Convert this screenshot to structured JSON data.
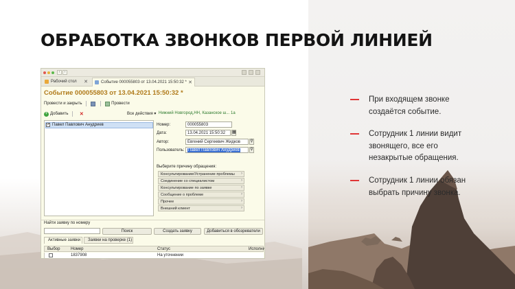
{
  "slide": {
    "title": "ОБРАБОТКА ЗВОНКОВ ПЕРВОЙ ЛИНИЕЙ",
    "accent_color": "#e03535",
    "bullets": [
      {
        "lines": [
          "При входящем звонке",
          "создаётся событие."
        ]
      },
      {
        "lines": [
          "Сотрудник 1 линии видит",
          "звонящего, все его",
          "незакрытые обращения."
        ]
      },
      {
        "lines": [
          "Сотрудник 1 линии обязан",
          "выбрать причину звонка."
        ]
      }
    ]
  },
  "app": {
    "tabs": [
      {
        "label": "Рабочий стол"
      },
      {
        "label": "Событие 000055803 от 13.04.2021 15:50:32 *"
      }
    ],
    "document_title": "Событие 000055803 от 13.04.2021 15:50:32 *",
    "toolbar": {
      "post_close_label": "Провести и закрыть",
      "post_label": "Провести"
    },
    "list_toolbar": {
      "add_label": "Добавить",
      "all_actions_label": "Все действия ▾",
      "org_link": "Нижний Новгород,НН, Казанское ш...  1а"
    },
    "list_items": [
      {
        "label": "Павел Павлович Анудриев",
        "checked": true
      }
    ],
    "fields": {
      "number_label": "Номер:",
      "number_value": "000055803",
      "date_label": "Дата:",
      "date_value": "13.04.2021 15:50:32",
      "author_label": "Автор:",
      "author_value": "Евгений Сергеевич Жидков",
      "user_label": "Пользователь:",
      "user_value": "Павел Павлович Анудриев"
    },
    "reasons": {
      "label": "Выберите причину обращения:",
      "items": [
        "Консультирование/Устранение проблемы",
        "Соединение со специалистом",
        "Консультирование по заявке",
        "Сообщение о проблеме",
        "Прочее",
        "Внешний клиент"
      ]
    },
    "find": {
      "label": "Найти заявку по номеру",
      "search_button": "Поиск",
      "create_button": "Создать заявку",
      "add_observer_button": "Добавиться в обозреватели"
    },
    "bottom_tabs": [
      {
        "label": "Активные заявки"
      },
      {
        "label": "Заявки на проверке (1)"
      }
    ],
    "grid": {
      "columns": [
        "Выбор",
        "Номер",
        "Статус",
        "Исполни"
      ],
      "rows": [
        {
          "checked": false,
          "number": "1837908",
          "status": "На уточнении",
          "executor": ""
        }
      ]
    }
  }
}
